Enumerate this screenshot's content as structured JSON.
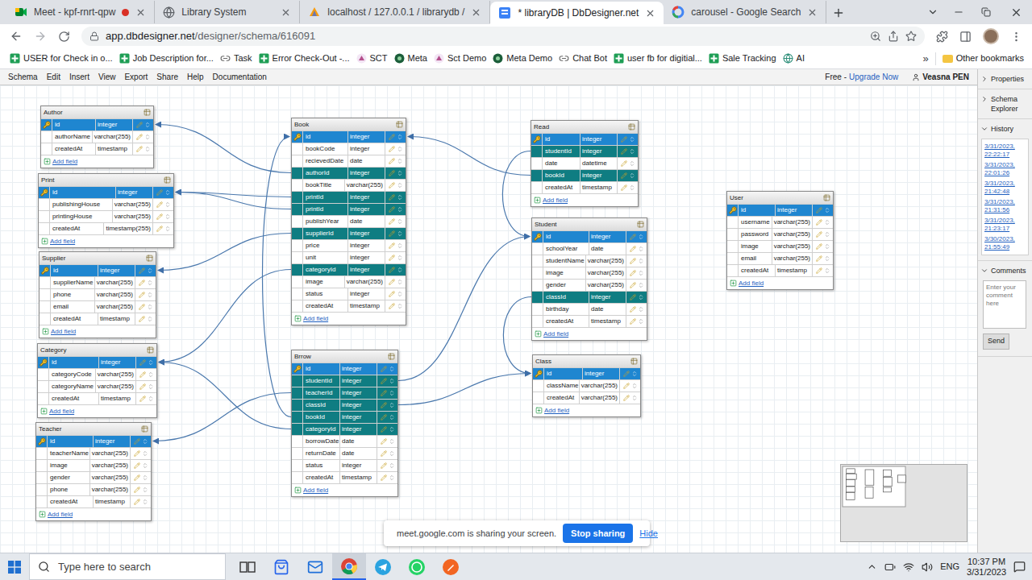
{
  "browser": {
    "tabs": [
      {
        "title": "Meet - kpf-rnrt-qpw",
        "selected": false,
        "recording": true,
        "kind": "meet"
      },
      {
        "title": "Library System",
        "selected": false,
        "recording": false,
        "kind": "globe"
      },
      {
        "title": "localhost / 127.0.0.1 / librarydb /",
        "selected": false,
        "recording": false,
        "kind": "pma"
      },
      {
        "title": "* libraryDB | DbDesigner.net",
        "selected": true,
        "recording": false,
        "kind": "dbd"
      },
      {
        "title": "carousel - Google Search",
        "selected": false,
        "recording": false,
        "kind": "google"
      }
    ],
    "url_host": "app.dbdesigner.net",
    "url_path": "/designer/schema/616091",
    "bookmarks": [
      {
        "label": "USER for Check in o...",
        "kind": "sheet"
      },
      {
        "label": "Job Description for...",
        "kind": "sheet"
      },
      {
        "label": "Task",
        "kind": "link"
      },
      {
        "label": "Error Check-Out -...",
        "kind": "sheet"
      },
      {
        "label": "SCT",
        "kind": "pink"
      },
      {
        "label": "Meta",
        "kind": "circle"
      },
      {
        "label": "Sct Demo",
        "kind": "pink"
      },
      {
        "label": "Meta Demo",
        "kind": "circle"
      },
      {
        "label": "Chat Bot",
        "kind": "link"
      },
      {
        "label": "user fb for digitial...",
        "kind": "sheet"
      },
      {
        "label": "Sale Tracking",
        "kind": "sheet"
      },
      {
        "label": "AI",
        "kind": "globe"
      }
    ],
    "more_bookmarks": "»",
    "other_bookmarks": "Other bookmarks"
  },
  "app": {
    "menu": [
      "Schema",
      "Edit",
      "Insert",
      "View",
      "Export",
      "Share",
      "Help",
      "Documentation"
    ],
    "plan": "Free -",
    "upgrade": "Upgrade Now",
    "user": "Veasna PEN"
  },
  "diagram": {
    "add_field": "Add field",
    "tables": [
      {
        "name": "Author",
        "fields": [
          {
            "name": "id",
            "type": "integer",
            "kind": "pk"
          },
          {
            "name": "authorName",
            "type": "varchar(255)",
            "kind": "field"
          },
          {
            "name": "createdAt",
            "type": "timestamp",
            "kind": "field"
          }
        ]
      },
      {
        "name": "Print",
        "fields": [
          {
            "name": "id",
            "type": "integer",
            "kind": "pk"
          },
          {
            "name": "publishingHouse",
            "type": "varchar(255)",
            "kind": "field"
          },
          {
            "name": "printingHouse",
            "type": "varchar(255)",
            "kind": "field"
          },
          {
            "name": "createdAt",
            "type": "timestamp(255)",
            "kind": "field"
          }
        ]
      },
      {
        "name": "Supplier",
        "fields": [
          {
            "name": "id",
            "type": "integer",
            "kind": "pk"
          },
          {
            "name": "supplierName",
            "type": "varchar(255)",
            "kind": "field"
          },
          {
            "name": "phone",
            "type": "varchar(255)",
            "kind": "field"
          },
          {
            "name": "email",
            "type": "varchar(255)",
            "kind": "field"
          },
          {
            "name": "createdAt",
            "type": "timestamp",
            "kind": "field"
          }
        ]
      },
      {
        "name": "Category",
        "fields": [
          {
            "name": "id",
            "type": "integer",
            "kind": "pk"
          },
          {
            "name": "categoryCode",
            "type": "varchar(255)",
            "kind": "field"
          },
          {
            "name": "categoryName",
            "type": "varchar(255)",
            "kind": "field"
          },
          {
            "name": "createdAt",
            "type": "timestamp",
            "kind": "field"
          }
        ]
      },
      {
        "name": "Teacher",
        "fields": [
          {
            "name": "id",
            "type": "integer",
            "kind": "pk"
          },
          {
            "name": "teacherName",
            "type": "varchar(255)",
            "kind": "field"
          },
          {
            "name": "image",
            "type": "varchar(255)",
            "kind": "field"
          },
          {
            "name": "gender",
            "type": "varchar(255)",
            "kind": "field"
          },
          {
            "name": "phone",
            "type": "varchar(255)",
            "kind": "field"
          },
          {
            "name": "createdAt",
            "type": "timestamp",
            "kind": "field"
          }
        ]
      },
      {
        "name": "Book",
        "fields": [
          {
            "name": "id",
            "type": "integer",
            "kind": "pk"
          },
          {
            "name": "bookCode",
            "type": "integer",
            "kind": "field"
          },
          {
            "name": "recievedDate",
            "type": "date",
            "kind": "field"
          },
          {
            "name": "authorId",
            "type": "integer",
            "kind": "fk"
          },
          {
            "name": "bookTitle",
            "type": "varchar(255)",
            "kind": "field"
          },
          {
            "name": "printId",
            "type": "integer",
            "kind": "fk"
          },
          {
            "name": "printId",
            "type": "integer",
            "kind": "fk"
          },
          {
            "name": "publishYear",
            "type": "date",
            "kind": "field"
          },
          {
            "name": "supplierId",
            "type": "integer",
            "kind": "fk"
          },
          {
            "name": "price",
            "type": "integer",
            "kind": "field"
          },
          {
            "name": "unit",
            "type": "integer",
            "kind": "field"
          },
          {
            "name": "categoryId",
            "type": "integer",
            "kind": "fk"
          },
          {
            "name": "image",
            "type": "varchar(255)",
            "kind": "field"
          },
          {
            "name": "status",
            "type": "integer",
            "kind": "field"
          },
          {
            "name": "createdAt",
            "type": "timestamp",
            "kind": "field"
          }
        ]
      },
      {
        "name": "Brrow",
        "fields": [
          {
            "name": "id",
            "type": "integer",
            "kind": "pk"
          },
          {
            "name": "studentId",
            "type": "integer",
            "kind": "fk"
          },
          {
            "name": "teacherId",
            "type": "integer",
            "kind": "fk"
          },
          {
            "name": "classId",
            "type": "integer",
            "kind": "fk"
          },
          {
            "name": "bookId",
            "type": "integer",
            "kind": "fk"
          },
          {
            "name": "categoryId",
            "type": "integer",
            "kind": "fk"
          },
          {
            "name": "borrowDate",
            "type": "date",
            "kind": "field"
          },
          {
            "name": "returnDate",
            "type": "date",
            "kind": "field"
          },
          {
            "name": "status",
            "type": "integer",
            "kind": "field"
          },
          {
            "name": "createdAt",
            "type": "timestamp",
            "kind": "field"
          }
        ]
      },
      {
        "name": "Read",
        "fields": [
          {
            "name": "id",
            "type": "integer",
            "kind": "pk"
          },
          {
            "name": "studentId",
            "type": "integer",
            "kind": "fk"
          },
          {
            "name": "date",
            "type": "datetime",
            "kind": "field"
          },
          {
            "name": "bookId",
            "type": "integer",
            "kind": "fk"
          },
          {
            "name": "createdAt",
            "type": "timestamp",
            "kind": "field"
          }
        ]
      },
      {
        "name": "Student",
        "fields": [
          {
            "name": "id",
            "type": "integer",
            "kind": "pk"
          },
          {
            "name": "schoolYear",
            "type": "date",
            "kind": "field"
          },
          {
            "name": "studentName",
            "type": "varchar(255)",
            "kind": "field"
          },
          {
            "name": "image",
            "type": "varchar(255)",
            "kind": "field"
          },
          {
            "name": "gender",
            "type": "varchar(255)",
            "kind": "field"
          },
          {
            "name": "classId",
            "type": "integer",
            "kind": "fk"
          },
          {
            "name": "birthday",
            "type": "date",
            "kind": "field"
          },
          {
            "name": "createdAt",
            "type": "timestamp",
            "kind": "field"
          }
        ]
      },
      {
        "name": "Class",
        "fields": [
          {
            "name": "id",
            "type": "integer",
            "kind": "pk"
          },
          {
            "name": "className",
            "type": "varchar(255)",
            "kind": "field"
          },
          {
            "name": "createdAt",
            "type": "varchar(255)",
            "kind": "field"
          }
        ]
      },
      {
        "name": "User",
        "fields": [
          {
            "name": "id",
            "type": "integer",
            "kind": "pk"
          },
          {
            "name": "username",
            "type": "varchar(255)",
            "kind": "field"
          },
          {
            "name": "password",
            "type": "varchar(255)",
            "kind": "field"
          },
          {
            "name": "image",
            "type": "varchar(255)",
            "kind": "field"
          },
          {
            "name": "email",
            "type": "varchar(255)",
            "kind": "field"
          },
          {
            "name": "createdAt",
            "type": "timestamp",
            "kind": "field"
          }
        ]
      }
    ],
    "relations": [
      {
        "from": "Book",
        "field": "authorId",
        "to": "Author"
      },
      {
        "from": "Book",
        "field": "printId",
        "to": "Print"
      },
      {
        "from": "Book",
        "field": "printId",
        "to": "Print"
      },
      {
        "from": "Book",
        "field": "supplierId",
        "to": "Supplier"
      },
      {
        "from": "Book",
        "field": "categoryId",
        "to": "Category"
      },
      {
        "from": "Brrow",
        "field": "categoryId",
        "to": "Category"
      },
      {
        "from": "Brrow",
        "field": "teacherId",
        "to": "Teacher"
      },
      {
        "from": "Brrow",
        "field": "bookId",
        "to": "Book"
      },
      {
        "from": "Read",
        "field": "bookId",
        "to": "Book"
      },
      {
        "from": "Read",
        "field": "studentId",
        "to": "Student"
      },
      {
        "from": "Brrow",
        "field": "studentId",
        "to": "Student"
      },
      {
        "from": "Student",
        "field": "classId",
        "to": "Class"
      },
      {
        "from": "Brrow",
        "field": "classId",
        "to": "Class"
      }
    ]
  },
  "side_panel": {
    "sections": [
      {
        "label": "Properties",
        "expanded": false,
        "kind": "plain"
      },
      {
        "label": "Schema Explorer",
        "expanded": false,
        "kind": "plain"
      },
      {
        "label": "History",
        "expanded": true,
        "kind": "history"
      },
      {
        "label": "Comments",
        "expanded": true,
        "kind": "comments"
      }
    ],
    "history": [
      "3/31/2023, 22:22:17",
      "3/31/2023, 22:01:26",
      "3/31/2023, 21:42:48",
      "3/31/2023, 21:31:56",
      "3/31/2023, 21:23:17",
      "3/30/2023, 21:55:49"
    ],
    "comment_placeholder": "Enter your comment here",
    "send": "Send"
  },
  "share_banner": {
    "text": "meet.google.com is sharing your screen.",
    "stop": "Stop sharing",
    "hide": "Hide"
  },
  "taskbar": {
    "search_placeholder": "Type here to search",
    "apps": [
      {
        "kind": "taskview",
        "active": false
      },
      {
        "kind": "store",
        "active": false
      },
      {
        "kind": "mail",
        "active": false
      },
      {
        "kind": "chrome",
        "active": true
      },
      {
        "kind": "telegram",
        "active": false
      },
      {
        "kind": "whatsapp",
        "active": false
      },
      {
        "kind": "draw",
        "active": false
      }
    ],
    "language": "ENG",
    "time": "10:37 PM",
    "date": "3/31/2023"
  }
}
